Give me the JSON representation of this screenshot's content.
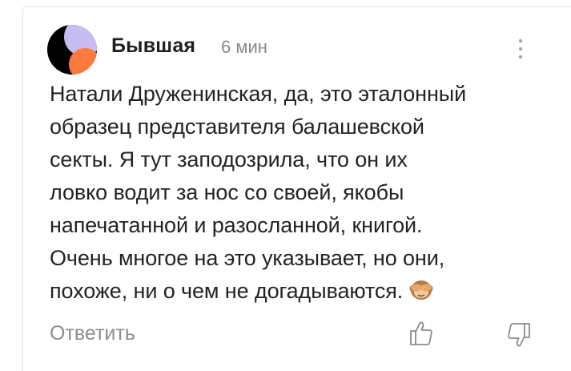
{
  "comment": {
    "author": "Бывшая",
    "time": "6 мин",
    "text_lines": [
      "Натали Друженинская, да, это эталонный",
      "образец представителя балашевской",
      "секты. Я тут заподозрила, что он их",
      "ловко водит за нос со своей, якобы",
      "напечатанной и разосланной, книгой.",
      "Очень многое на это указывает, но они,",
      "похоже, ни о чем не догадываются."
    ],
    "emoji": "see-no-evil-monkey-icon",
    "reply_label": "Ответить"
  },
  "icons": {
    "avatar": "avatar-circle-icon",
    "more": "more-vertical-icon",
    "like": "thumbs-up-icon",
    "dislike": "thumbs-down-icon"
  },
  "colors": {
    "avatar_black": "#000000",
    "avatar_lavender": "#c7bdf2",
    "avatar_orange": "#ff7a3d",
    "text_primary": "#232323",
    "text_secondary": "#8c8c8c"
  }
}
